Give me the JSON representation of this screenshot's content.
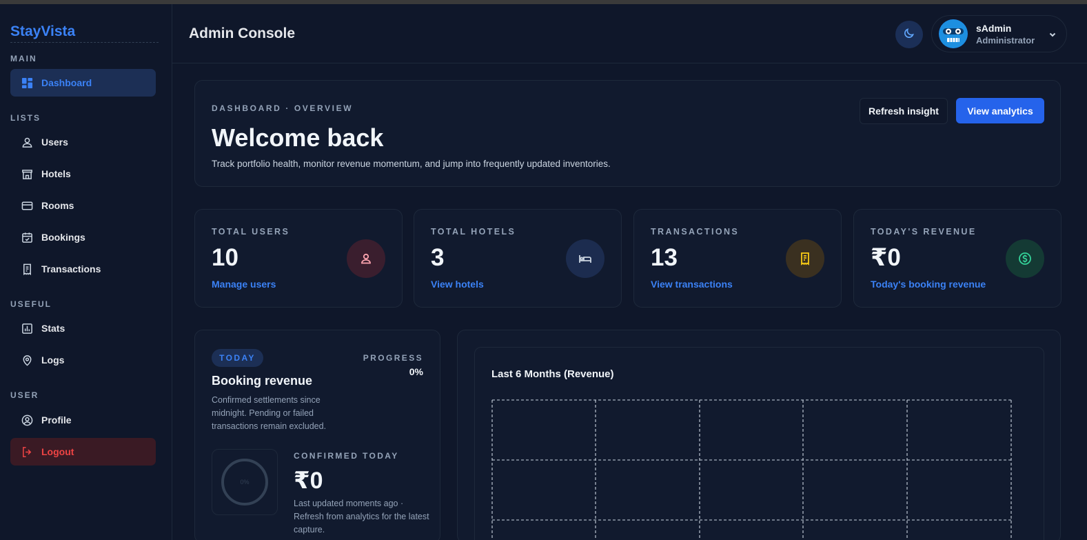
{
  "brand": "StayVista",
  "sidebar": {
    "sections": {
      "main": "MAIN",
      "lists": "LISTS",
      "useful": "USEFUL",
      "user": "USER"
    },
    "items": {
      "dashboard": "Dashboard",
      "users": "Users",
      "hotels": "Hotels",
      "rooms": "Rooms",
      "bookings": "Bookings",
      "transactions": "Transactions",
      "stats": "Stats",
      "logs": "Logs",
      "profile": "Profile",
      "logout": "Logout"
    }
  },
  "header": {
    "title": "Admin Console",
    "user_name": "sAdmin",
    "user_role": "Administrator"
  },
  "hero": {
    "kicker": "DASHBOARD · OVERVIEW",
    "title": "Welcome back",
    "subtitle": "Track portfolio health, monitor revenue momentum, and jump into frequently updated inventories.",
    "refresh_label": "Refresh insight",
    "analytics_label": "View analytics"
  },
  "stats": {
    "users": {
      "label": "TOTAL USERS",
      "value": "10",
      "link": "Manage users",
      "icon": "user-icon",
      "color": "#fda4af"
    },
    "hotels": {
      "label": "TOTAL HOTELS",
      "value": "3",
      "link": "View hotels",
      "icon": "bed-icon",
      "color": "#cbd5e1"
    },
    "transactions": {
      "label": "TRANSACTIONS",
      "value": "13",
      "link": "View transactions",
      "icon": "receipt-icon",
      "color": "#facc15"
    },
    "revenue": {
      "label": "TODAY'S REVENUE",
      "value": "₹0",
      "link": "Today's booking revenue",
      "icon": "dollar-circle-icon",
      "color": "#34d399"
    }
  },
  "revenue_card": {
    "pill": "TODAY",
    "progress_label": "PROGRESS",
    "progress_value": "0%",
    "progress": 0,
    "title": "Booking revenue",
    "description": "Confirmed settlements since midnight. Pending or failed transactions remain excluded.",
    "ring_label": "0%",
    "confirmed_label": "CONFIRMED TODAY",
    "confirmed_value": "₹0",
    "note": "Last updated moments ago · Refresh from analytics for the latest capture."
  },
  "chart": {
    "title": "Last 6 Months (Revenue)"
  },
  "colors": {
    "accent": "#2563eb",
    "link": "#3b82f6",
    "danger": "#ef4444"
  }
}
